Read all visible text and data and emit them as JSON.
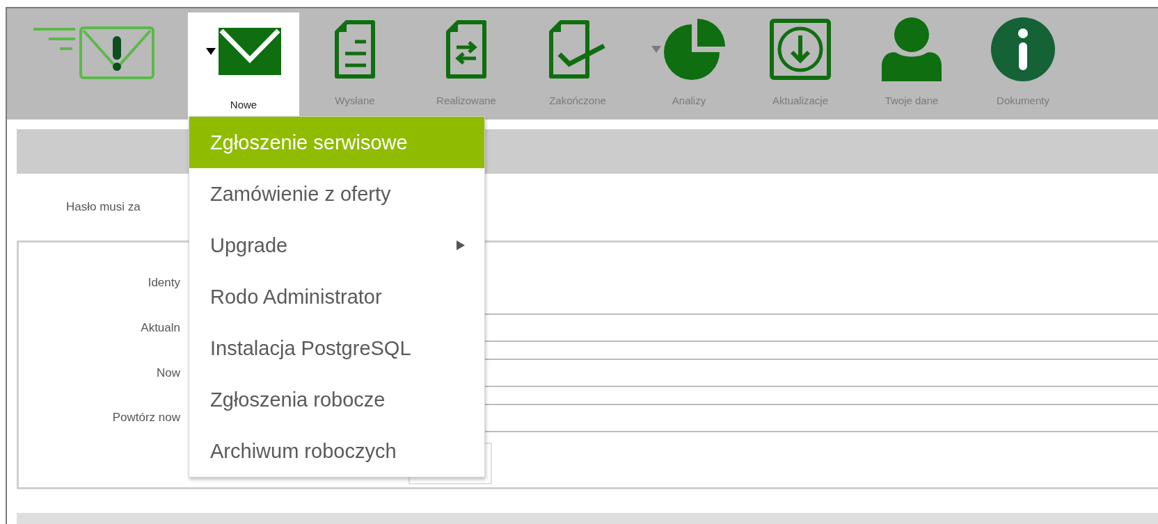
{
  "toolbar": {
    "items": [
      {
        "label": "Nowe",
        "selected": true,
        "dropdown": true
      },
      {
        "label": "Wysłane",
        "selected": false,
        "dropdown": false
      },
      {
        "label": "Realizowane",
        "selected": false,
        "dropdown": false
      },
      {
        "label": "Zakończone",
        "selected": false,
        "dropdown": false
      },
      {
        "label": "Analizy",
        "selected": false,
        "dropdown": true
      },
      {
        "label": "Aktualizacje",
        "selected": false,
        "dropdown": false
      },
      {
        "label": "Twoje dane",
        "selected": false,
        "dropdown": false
      },
      {
        "label": "Dokumenty",
        "selected": false,
        "dropdown": false
      }
    ]
  },
  "menu": {
    "items": [
      {
        "label": "Zgłoszenie serwisowe",
        "selected": true,
        "submenu": false
      },
      {
        "label": "Zamówienie z oferty",
        "selected": false,
        "submenu": false
      },
      {
        "label": "Upgrade",
        "selected": false,
        "submenu": true
      },
      {
        "label": "Rodo Administrator",
        "selected": false,
        "submenu": false
      },
      {
        "label": "Instalacja PostgreSQL",
        "selected": false,
        "submenu": false
      },
      {
        "label": "Zgłoszenia robocze",
        "selected": false,
        "submenu": false
      },
      {
        "label": "Archiwum roboczych",
        "selected": false,
        "submenu": false
      }
    ]
  },
  "form": {
    "notice": "Hasło musi za",
    "fields": [
      {
        "label": "Identy",
        "kind": "text"
      },
      {
        "label": "Aktualn",
        "kind": "input"
      },
      {
        "label": "Now",
        "kind": "input"
      },
      {
        "label": "Powtórz now",
        "kind": "input"
      }
    ],
    "button": {
      "kind": "button"
    }
  }
}
